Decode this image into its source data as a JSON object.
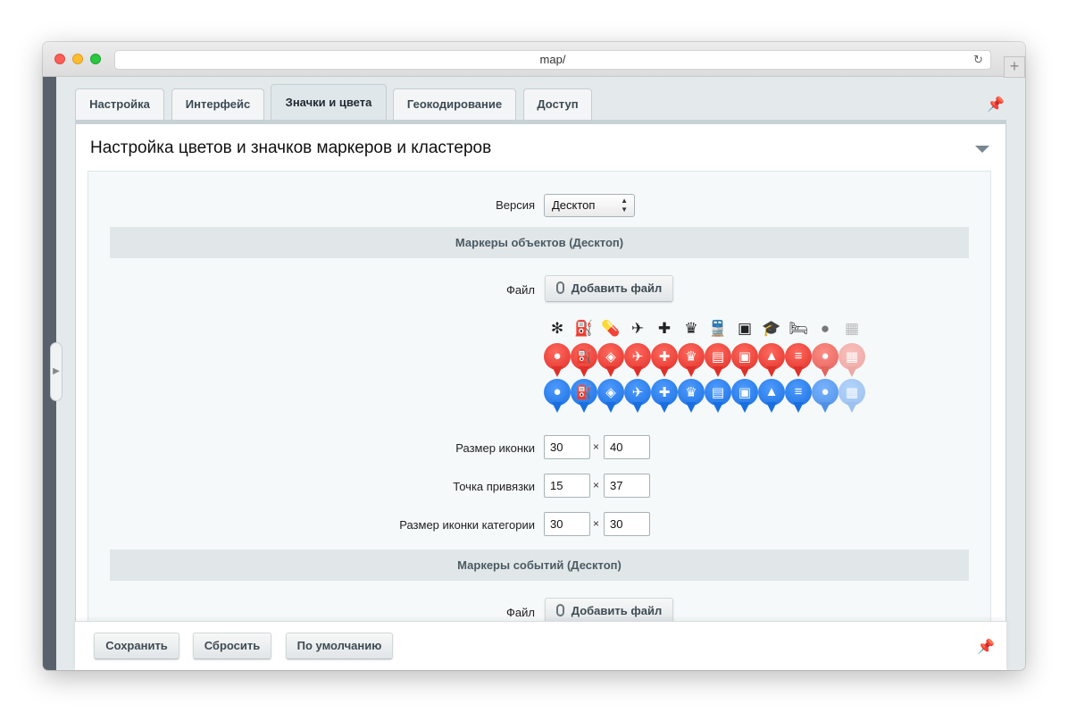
{
  "browser": {
    "url": "map/",
    "reload_icon": "reload-icon",
    "new_tab": "+"
  },
  "tabs": [
    {
      "label": "Настройка",
      "active": false
    },
    {
      "label": "Интерфейс",
      "active": false
    },
    {
      "label": "Значки и цвета",
      "active": true
    },
    {
      "label": "Геокодирование",
      "active": false
    },
    {
      "label": "Доступ",
      "active": false
    }
  ],
  "panel": {
    "title": "Настройка цветов и значков маркеров и кластеров",
    "version_label": "Версия",
    "version_value": "Десктоп",
    "section_objects": "Маркеры объектов (Десктоп)",
    "section_events": "Маркеры событий (Десктоп)",
    "file_label": "Файл",
    "add_file": "Добавить файл",
    "icon_size_label": "Размер иконки",
    "icon_size_w": "30",
    "icon_size_h": "40",
    "anchor_label": "Точка привязки",
    "anchor_x": "15",
    "anchor_y": "37",
    "category_size_label": "Размер иконки категории",
    "category_size_w": "30",
    "category_size_h": "30",
    "times": "×"
  },
  "icon_set": [
    "sun-icon",
    "fuel-icon",
    "pill-icon",
    "plane-icon",
    "cross-icon",
    "emblem-icon",
    "train-icon",
    "stamp-icon",
    "graduation-cap-icon",
    "bed-icon",
    "pets-icon",
    "blocks-icon"
  ],
  "colors": {
    "red_marker": "#e0302a",
    "blue_marker": "#1a6fe0"
  },
  "footer": {
    "save": "Сохранить",
    "reset": "Сбросить",
    "default": "По умолчанию"
  }
}
